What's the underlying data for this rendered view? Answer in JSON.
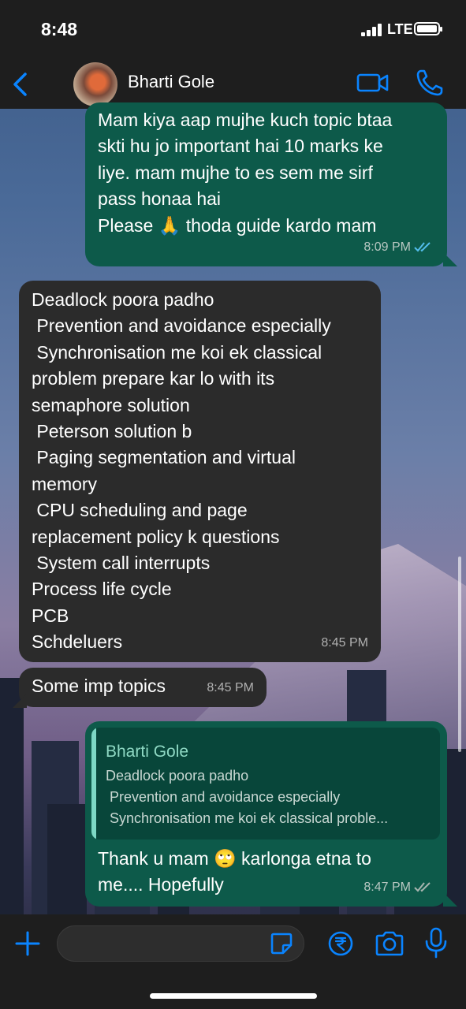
{
  "status_bar": {
    "time": "8:48",
    "network": "LTE"
  },
  "header": {
    "contact_name": "Bharti Gole"
  },
  "messages": [
    {
      "direction": "out",
      "text": "Mam kiya aap mujhe kuch topic btaa\nskti hu jo important hai 10 marks ke\nliye. mam mujhe to es sem me sirf\npass honaa hai\nPlease 🙏 thoda guide kardo mam",
      "time": "8:09 PM"
    },
    {
      "direction": "in",
      "text": "Deadlock poora padho\n Prevention and avoidance especially\n Synchronisation me koi ek classical\nproblem prepare kar lo with its\nsemaphore solution\n Peterson solution b\n Paging segmentation and virtual\nmemory\n CPU scheduling and page\nreplacement policy k questions\n System call interrupts\nProcess life cycle\nPCB\nSchdeluers",
      "time": "8:45 PM"
    },
    {
      "direction": "in",
      "text": "Some imp topics",
      "time": "8:45 PM"
    },
    {
      "direction": "out",
      "text": "Thank u mam 🙄 karlonga etna to\nme.... Hopefully",
      "time": "8:47 PM",
      "quote": {
        "sender": "Bharti Gole",
        "text": "Deadlock poora padho\n Prevention and avoidance especially\n Synchronisation me koi ek classical proble..."
      }
    }
  ],
  "colors": {
    "accent": "#0a84ff",
    "outgoing_bubble": "#0d5a4a",
    "incoming_bubble": "#2b2b2b",
    "read_ticks": "#53bdeb"
  },
  "icons": {
    "back": "chevron-left-icon",
    "video": "video-camera-icon",
    "call": "phone-icon",
    "attach": "plus-icon",
    "sticker": "sticker-icon",
    "payment": "rupee-icon",
    "camera": "camera-icon",
    "voice": "microphone-icon"
  }
}
